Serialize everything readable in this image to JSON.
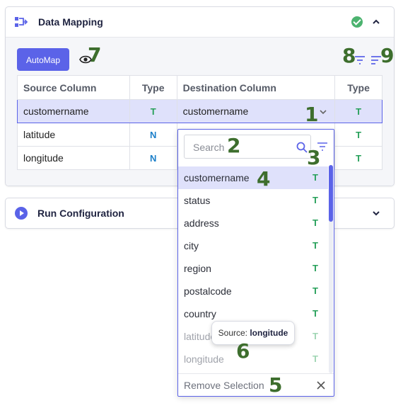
{
  "mapping_panel": {
    "title": "Data Mapping",
    "status_icon": "check-circle-icon",
    "collapse_icon": "chevron-up-icon",
    "automap_label": "AutoMap",
    "preview_icon": "eye-icon"
  },
  "table": {
    "headers": [
      "Source Column",
      "Type",
      "Destination Column",
      "Type"
    ],
    "rows": [
      {
        "source": "customername",
        "source_type": "T",
        "destination": "customername",
        "dest_type": "T",
        "selected": true
      },
      {
        "source": "latitude",
        "source_type": "N",
        "destination": "",
        "dest_type": "T",
        "selected": false
      },
      {
        "source": "longitude",
        "source_type": "N",
        "destination": "",
        "dest_type": "T",
        "selected": false
      }
    ]
  },
  "dropdown": {
    "search_placeholder": "Search",
    "options": [
      {
        "label": "customername",
        "type": "T"
      },
      {
        "label": "status",
        "type": "T"
      },
      {
        "label": "address",
        "type": "T"
      },
      {
        "label": "city",
        "type": "T"
      },
      {
        "label": "region",
        "type": "T"
      },
      {
        "label": "postalcode",
        "type": "T"
      },
      {
        "label": "country",
        "type": "T"
      },
      {
        "label": "latitude",
        "type": "T"
      },
      {
        "label": "longitude",
        "type": "T"
      }
    ],
    "remove_label": "Remove Selection"
  },
  "tooltip": {
    "prefix": "Source:",
    "value": "longitude"
  },
  "run_panel": {
    "title": "Run Configuration",
    "expand_icon": "chevron-down-icon"
  },
  "callouts": {
    "n1": "1",
    "n2": "2",
    "n3": "3",
    "n4": "4",
    "n5": "5",
    "n6": "6",
    "n7": "7",
    "n8": "8",
    "n9": "9"
  },
  "colors": {
    "accent": "#5b63e8",
    "text_type": "#27a05a",
    "numeric_type": "#1b7fc9",
    "success": "#4cb36f",
    "callout": "#3d6e2d"
  }
}
